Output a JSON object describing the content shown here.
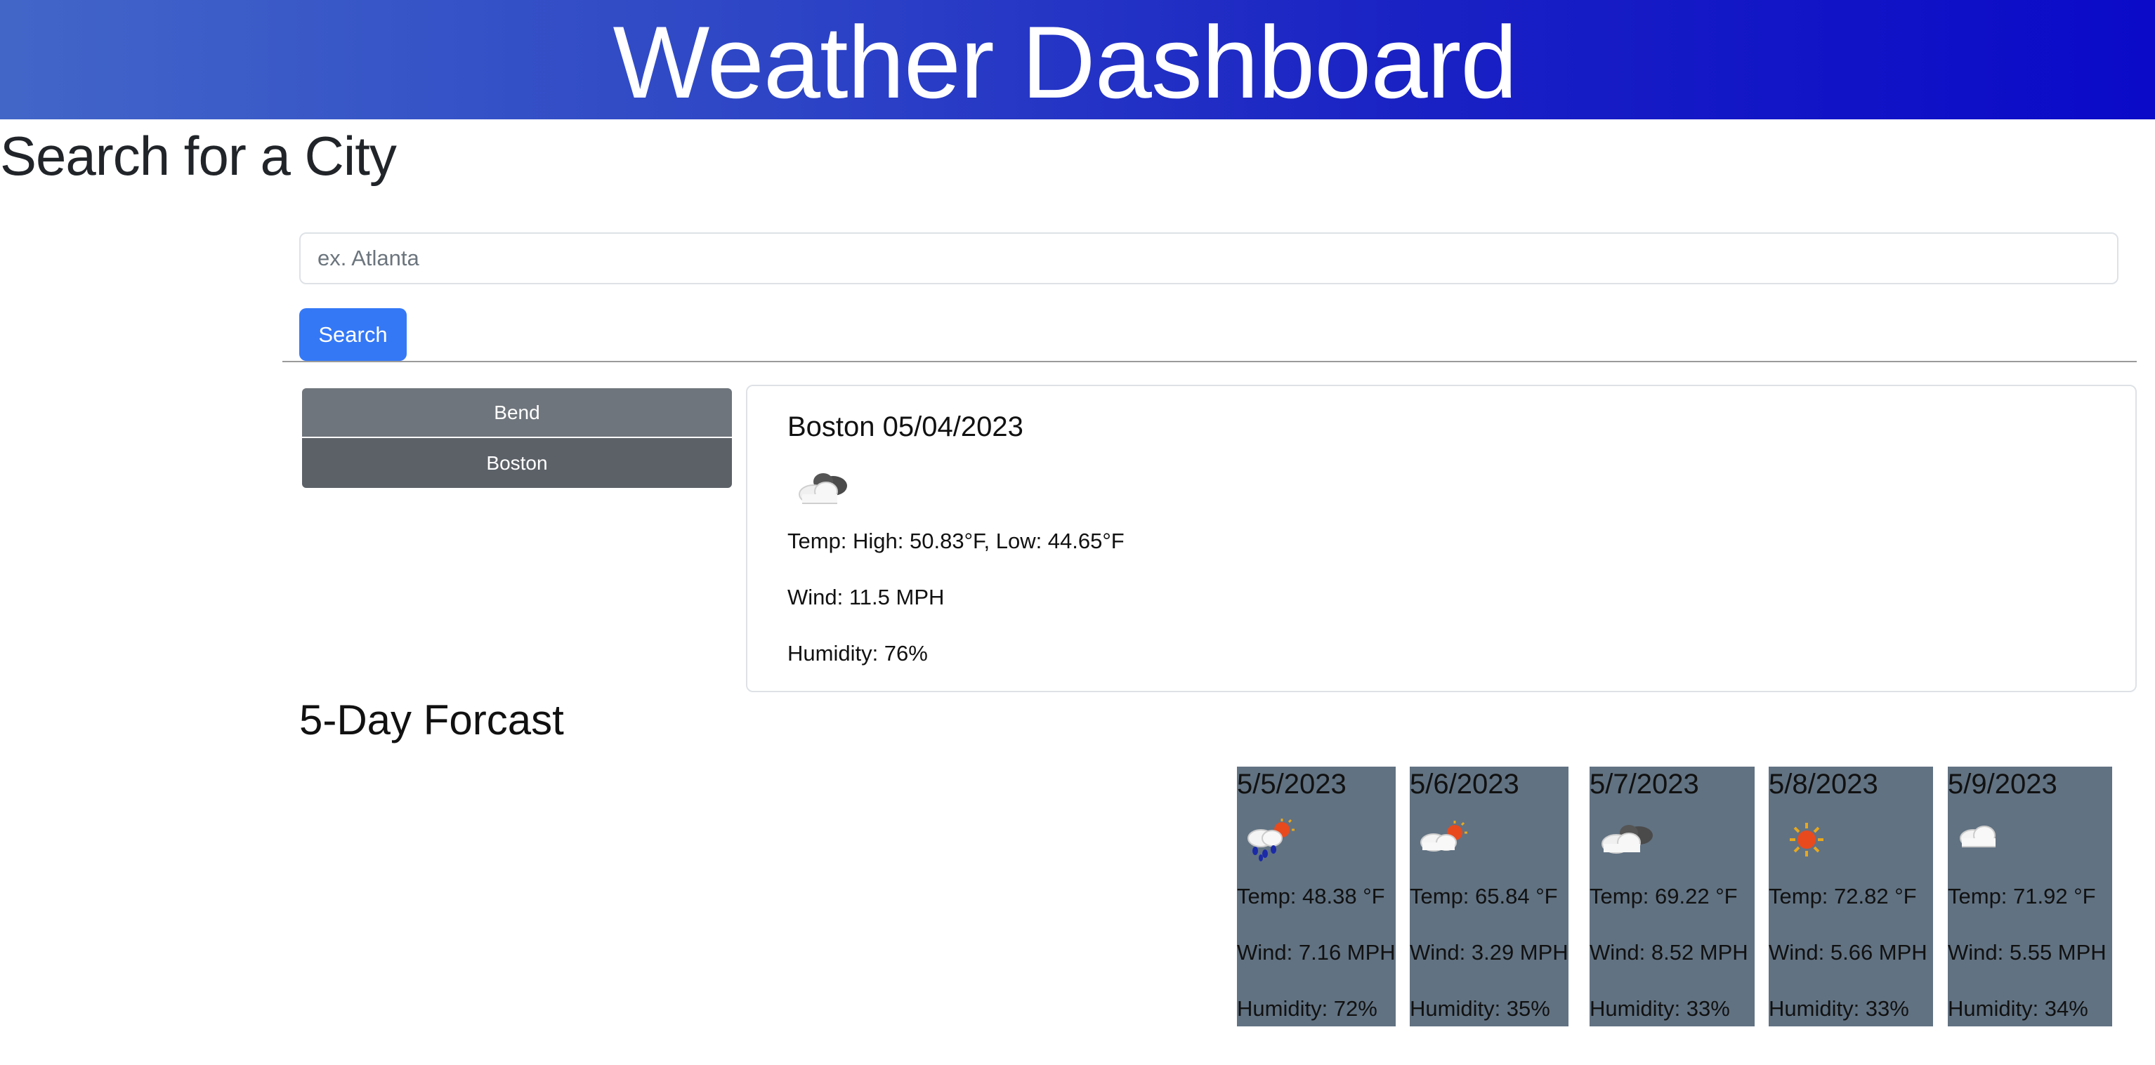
{
  "header": {
    "title": "Weather Dashboard"
  },
  "search": {
    "heading": "Search for a City",
    "placeholder": "ex. Atlanta",
    "button_label": "Search"
  },
  "history": {
    "items": [
      {
        "label": "Bend"
      },
      {
        "label": "Boston"
      }
    ]
  },
  "current": {
    "title": "Boston 05/04/2023",
    "icon": "cloudy-icon",
    "temp": "Temp: High: 50.83°F, Low: 44.65°F",
    "wind": "Wind: 11.5 MPH",
    "humidity": "Humidity: 76%"
  },
  "forecast": {
    "heading": "5-Day Forcast",
    "days": [
      {
        "date": "5/5/2023",
        "icon": "rain-sun-icon",
        "temp": "Temp: 48.38 °F",
        "wind": "Wind: 7.16 MPH",
        "humidity": "Humidity: 72%"
      },
      {
        "date": "5/6/2023",
        "icon": "partly-sunny-icon",
        "temp": "Temp: 65.84 °F",
        "wind": "Wind: 3.29 MPH",
        "humidity": "Humidity: 35%"
      },
      {
        "date": "5/7/2023",
        "icon": "broken-clouds-icon",
        "temp": "Temp: 69.22 °F",
        "wind": "Wind: 8.52 MPH",
        "humidity": "Humidity: 33%"
      },
      {
        "date": "5/8/2023",
        "icon": "sun-icon",
        "temp": "Temp: 72.82 °F",
        "wind": "Wind: 5.66 MPH",
        "humidity": "Humidity: 33%"
      },
      {
        "date": "5/9/2023",
        "icon": "cloud-icon",
        "temp": "Temp: 71.92 °F",
        "wind": "Wind: 5.55 MPH",
        "humidity": "Humidity: 34%"
      }
    ]
  },
  "colors": {
    "header_gradient_start": "#4266c8",
    "header_gradient_end": "#0a0ac8",
    "search_button": "#3478f6",
    "history_button": "#6f757c",
    "forecast_card": "#617282"
  }
}
